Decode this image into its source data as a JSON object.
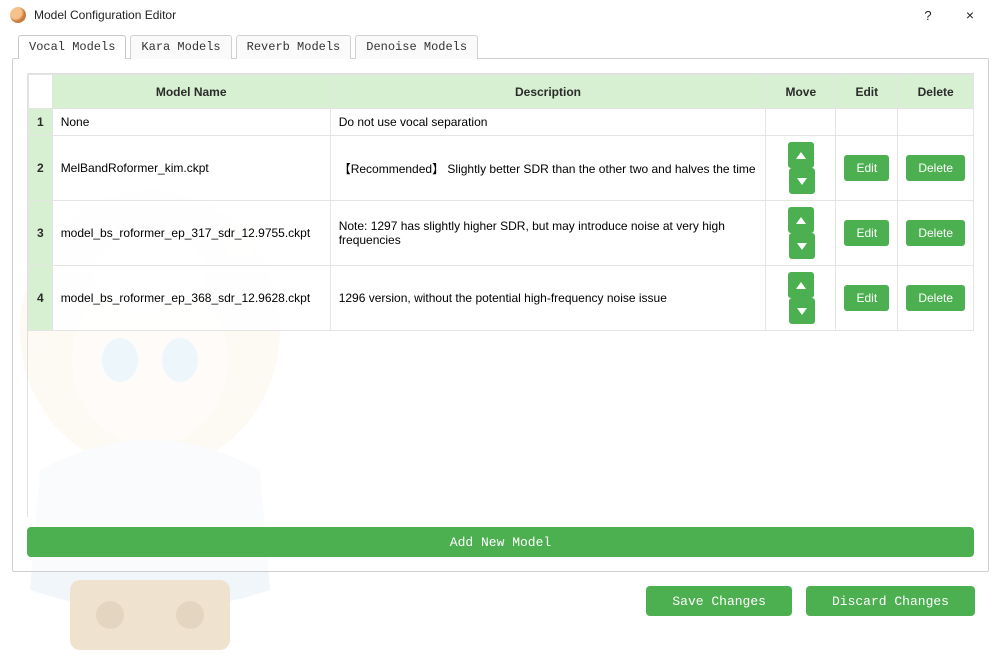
{
  "window": {
    "title": "Model Configuration Editor",
    "help_symbol": "?",
    "close_symbol": "×"
  },
  "tabs": [
    {
      "label": "Vocal Models",
      "active": true
    },
    {
      "label": "Kara Models",
      "active": false
    },
    {
      "label": "Reverb Models",
      "active": false
    },
    {
      "label": "Denoise Models",
      "active": false
    }
  ],
  "table": {
    "headers": {
      "name": "Model Name",
      "description": "Description",
      "move": "Move",
      "edit": "Edit",
      "delete": "Delete"
    },
    "edit_label": "Edit",
    "delete_label": "Delete",
    "rows": [
      {
        "num": "1",
        "name": "None",
        "description": "Do not use vocal separation",
        "actions": false
      },
      {
        "num": "2",
        "name": "MelBandRoformer_kim.ckpt",
        "description": "【Recommended】 Slightly better SDR than the other two and halves the time",
        "actions": true
      },
      {
        "num": "3",
        "name": "model_bs_roformer_ep_317_sdr_12.9755.ckpt",
        "description": "Note: 1297 has slightly higher SDR, but may introduce noise at very high frequencies",
        "actions": true
      },
      {
        "num": "4",
        "name": "model_bs_roformer_ep_368_sdr_12.9628.ckpt",
        "description": "1296 version, without the potential high-frequency noise issue",
        "actions": true
      }
    ]
  },
  "buttons": {
    "add_new_model": "Add New Model",
    "save_changes": "Save Changes",
    "discard_changes": "Discard Changes"
  },
  "colors": {
    "accent_green": "#4caf50",
    "header_green": "#d6f0d1"
  }
}
